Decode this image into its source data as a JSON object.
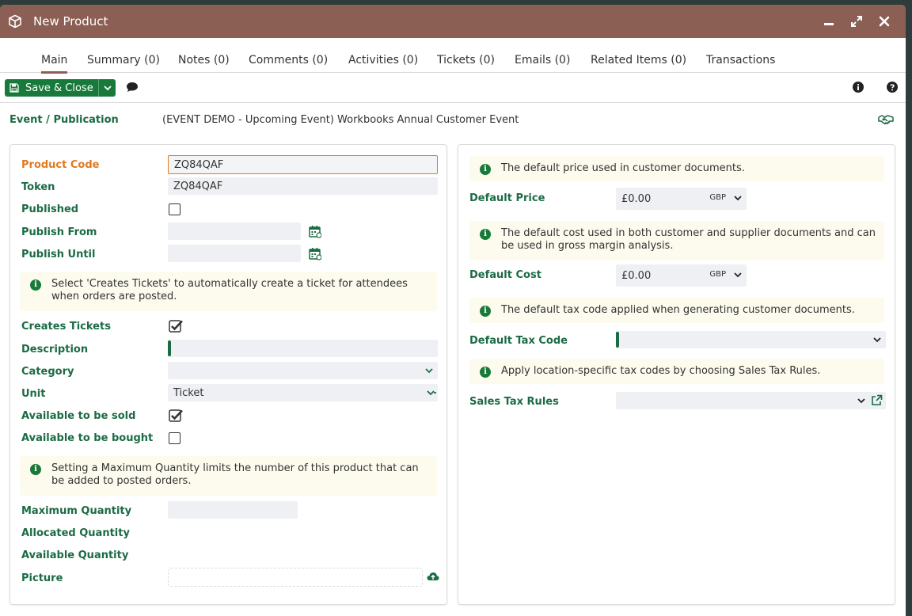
{
  "window": {
    "title": "New Product",
    "icon": "cube-icon"
  },
  "tabs": [
    {
      "label": "Main",
      "active": true
    },
    {
      "label": "Summary (0)"
    },
    {
      "label": "Notes (0)"
    },
    {
      "label": "Comments (0)"
    },
    {
      "label": "Activities (0)"
    },
    {
      "label": "Tickets (0)"
    },
    {
      "label": "Emails (0)"
    },
    {
      "label": "Related Items (0)"
    },
    {
      "label": "Transactions"
    }
  ],
  "toolbar": {
    "save_label": "Save & Close"
  },
  "event": {
    "label": "Event / Publication",
    "value": "(EVENT DEMO - Upcoming Event) Workbooks Annual Customer Event"
  },
  "left": {
    "product_code": {
      "label": "Product Code",
      "value": "ZQ84QAF"
    },
    "token": {
      "label": "Token",
      "value": "ZQ84QAF"
    },
    "published": {
      "label": "Published",
      "checked": false
    },
    "publish_from": {
      "label": "Publish From",
      "value": ""
    },
    "publish_until": {
      "label": "Publish Until",
      "value": ""
    },
    "info_tickets": "Select 'Creates Tickets' to automatically create a ticket for attendees when orders are posted.",
    "creates_tickets": {
      "label": "Creates Tickets",
      "checked": true
    },
    "description": {
      "label": "Description",
      "value": ""
    },
    "category": {
      "label": "Category",
      "value": ""
    },
    "unit": {
      "label": "Unit",
      "value": "Ticket"
    },
    "available_sold": {
      "label": "Available to be sold",
      "checked": true
    },
    "available_bought": {
      "label": "Available to be bought",
      "checked": false
    },
    "info_max": "Setting a Maximum Quantity limits the number of this product that can be added to posted orders.",
    "max_qty": {
      "label": "Maximum Quantity",
      "value": ""
    },
    "allocated_qty": {
      "label": "Allocated Quantity"
    },
    "available_qty": {
      "label": "Available Quantity"
    },
    "picture": {
      "label": "Picture"
    }
  },
  "right": {
    "info_price": "The default price used in customer documents.",
    "default_price": {
      "label": "Default Price",
      "value": "£0.00",
      "currency": "GBP"
    },
    "info_cost": "The default cost used in both customer and supplier documents and can be used in gross margin analysis.",
    "default_cost": {
      "label": "Default Cost",
      "value": "£0.00",
      "currency": "GBP"
    },
    "info_tax": "The default tax code applied when generating customer documents.",
    "default_tax": {
      "label": "Default Tax Code",
      "value": ""
    },
    "info_sales_tax": "Apply location-specific tax codes by choosing Sales Tax Rules.",
    "sales_tax_rules": {
      "label": "Sales Tax Rules",
      "value": ""
    }
  },
  "colors": {
    "titlebar": "#8b5f53",
    "accent_green": "#1b6b44",
    "required_orange": "#e07a1e"
  }
}
